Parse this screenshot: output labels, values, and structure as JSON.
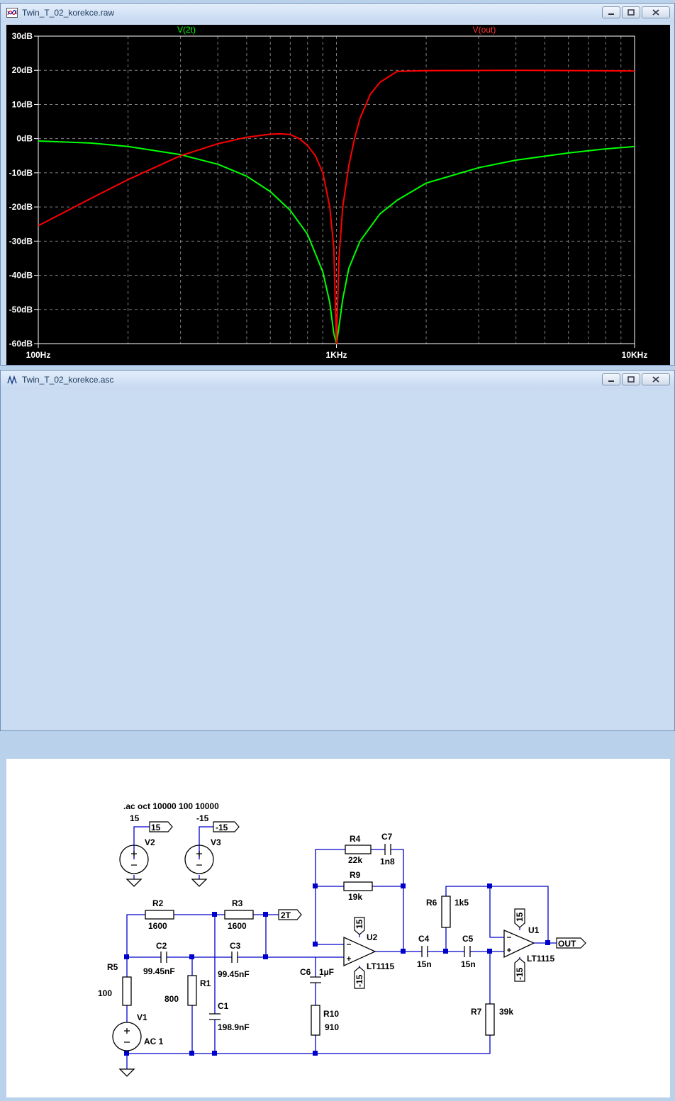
{
  "plot_window": {
    "title": "Twin_T_02_korekce.raw",
    "series_labels": {
      "v2t": "V(2t)",
      "vout": "V(out)"
    }
  },
  "schematic_window": {
    "title": "Twin_T_02_korekce.asc",
    "directive": ".ac oct 10000 100 10000",
    "labels": {
      "v2_value": "15",
      "v2_name": "V2",
      "v2_net": "15",
      "v3_value": "-15",
      "v3_name": "V3",
      "v3_net": "-15",
      "r2_name": "R2",
      "r2_value": "1600",
      "r3_name": "R3",
      "r3_value": "1600",
      "net_2t": "2T",
      "c2_name": "C2",
      "c2_value": "99.45nF",
      "c3_name": "C3",
      "c3_value": "99.45nF",
      "r5_name": "R5",
      "r5_value": "100",
      "r1_name": "R1",
      "r1_value": "800",
      "c1_name": "C1",
      "c1_value": "198.9nF",
      "v1_name": "V1",
      "v1_value": "AC 1",
      "r4_name": "R4",
      "r4_value": "22k",
      "c7_name": "C7",
      "c7_value": "1n8",
      "r9_name": "R9",
      "r9_value": "19k",
      "u2_name": "U2",
      "u2_model": "LT1115",
      "u2_vpos": "15",
      "u2_vneg": "-15",
      "c6_name": "C6",
      "c6_value": "1µF",
      "r10_name": "R10",
      "r10_value": "910",
      "c4_name": "C4",
      "c4_value": "15n",
      "c5_name": "C5",
      "c5_value": "15n",
      "r6_name": "R6",
      "r6_value": "1k5",
      "r7_name": "R7",
      "r7_value": "39k",
      "u1_name": "U1",
      "u1_model": "LT1115",
      "u1_vpos": "15",
      "u1_vneg": "-15",
      "net_out": "OUT"
    }
  },
  "chart_data": {
    "type": "line",
    "x_scale": "log",
    "xlim": [
      100,
      10000
    ],
    "ylim": [
      -60,
      30
    ],
    "x_ticks": [
      100,
      1000,
      10000
    ],
    "x_tick_labels": [
      "100Hz",
      "1KHz",
      "10KHz"
    ],
    "y_ticks": [
      30,
      20,
      10,
      0,
      -10,
      -20,
      -30,
      -40,
      -50,
      -60
    ],
    "y_tick_labels": [
      "30dB",
      "20dB",
      "10dB",
      "0dB",
      "-10dB",
      "-20dB",
      "-30dB",
      "-40dB",
      "-50dB",
      "-60dB"
    ],
    "grid": true,
    "series": [
      {
        "name": "V(2t)",
        "color": "#00ff00",
        "x": [
          100,
          150,
          200,
          300,
          400,
          500,
          600,
          700,
          800,
          900,
          950,
          980,
          1000,
          1020,
          1050,
          1100,
          1200,
          1400,
          1600,
          2000,
          3000,
          4000,
          6000,
          8000,
          10000
        ],
        "y": [
          -0.7,
          -1.3,
          -2.3,
          -4.7,
          -7.5,
          -11,
          -15.5,
          -21,
          -28,
          -39,
          -48,
          -57,
          -60,
          -55,
          -47,
          -38,
          -30,
          -22,
          -18,
          -13,
          -8.5,
          -6.3,
          -4.2,
          -3,
          -2.3
        ]
      },
      {
        "name": "V(out)",
        "color": "#ff0000",
        "x": [
          100,
          150,
          200,
          300,
          400,
          500,
          600,
          650,
          700,
          750,
          800,
          850,
          900,
          950,
          980,
          1000,
          1020,
          1050,
          1100,
          1150,
          1200,
          1300,
          1400,
          1600,
          2000,
          4000,
          10000
        ],
        "y": [
          -25.5,
          -17.5,
          -12,
          -5,
          -1.5,
          0.4,
          1.3,
          1.4,
          1.2,
          0,
          -2,
          -5,
          -10,
          -20,
          -32,
          -60,
          -35,
          -20,
          -8,
          0,
          6,
          13,
          16.5,
          19.7,
          19.9,
          20,
          19.8
        ]
      }
    ]
  }
}
